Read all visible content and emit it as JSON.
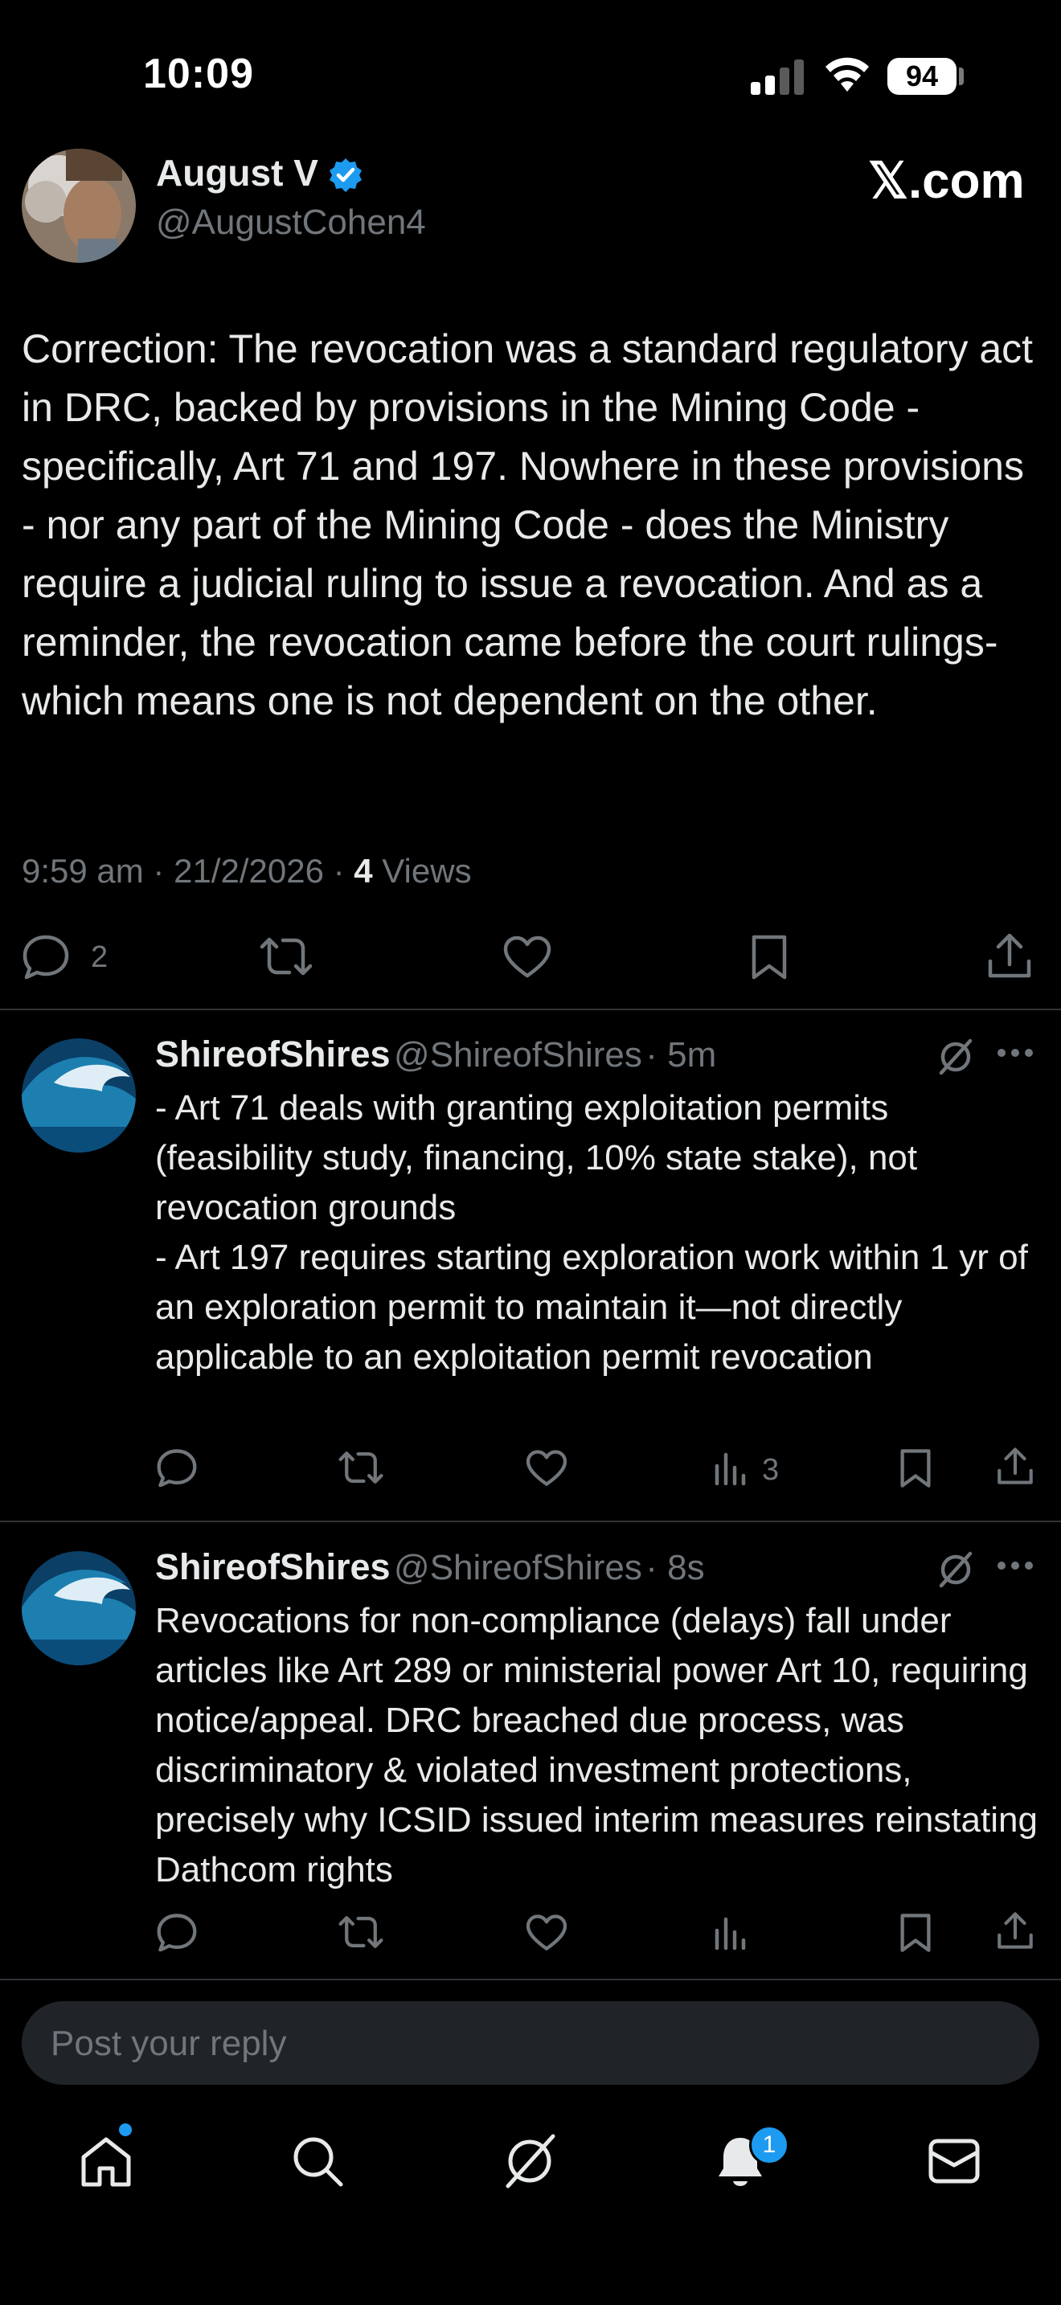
{
  "status_bar": {
    "time": "10:09",
    "battery": "94"
  },
  "tweet": {
    "author_name": "August V",
    "author_handle": "@AugustCohen4",
    "site": "𝕏.com",
    "text": "Correction: The revocation was a standard regulatory act in DRC, backed by provisions in the Mining Code - specifically, Art 71 and 197.  Nowhere in these provisions - nor any part of the Mining Code - does the Ministry require a judicial ruling to issue a revocation.  And as a reminder, the revocation came before the court rulings- which means one is not dependent on the other.",
    "time": "9:59 am · 21/2/2026 · ",
    "views_count": "4",
    "views_label": " Views",
    "reply_count": "2"
  },
  "replies": [
    {
      "name": "ShireofShires",
      "handle": "@ShireofShires",
      "time": "· 5m",
      "text": "- Art 71 deals with granting exploitation permits (feasibility study, financing, 10% state stake), not revocation grounds\n- Art 197 requires starting exploration work within 1 yr of an exploration permit to maintain it—not directly applicable to an exploitation permit revocation",
      "views_count": "3"
    },
    {
      "name": "ShireofShires",
      "handle": "@ShireofShires",
      "time": "· 8s",
      "text": "Revocations for non-compliance (delays) fall under articles like Art 289 or ministerial power Art 10, requiring notice/appeal. DRC breached due process, was discriminatory & violated investment protections, precisely why ICSID issued interim measures reinstating Dathcom rights",
      "views_count": ""
    }
  ],
  "composer": {
    "placeholder": "Post your reply"
  },
  "tab_bar": {
    "notifications_badge": "1"
  },
  "colors": {
    "background": "#000000",
    "text": "#e7e9ea",
    "muted": "#71767b",
    "verified": "#1d9bf0",
    "badge": "#1d9bf0"
  },
  "icons": [
    "signal-icon",
    "wifi-icon",
    "verified-icon",
    "reply-icon",
    "repost-icon",
    "like-icon",
    "views-icon",
    "bookmark-icon",
    "share-icon",
    "grok-icon",
    "more-icon",
    "home-icon",
    "search-icon",
    "grok-tab-icon",
    "notifications-icon",
    "messages-icon"
  ]
}
